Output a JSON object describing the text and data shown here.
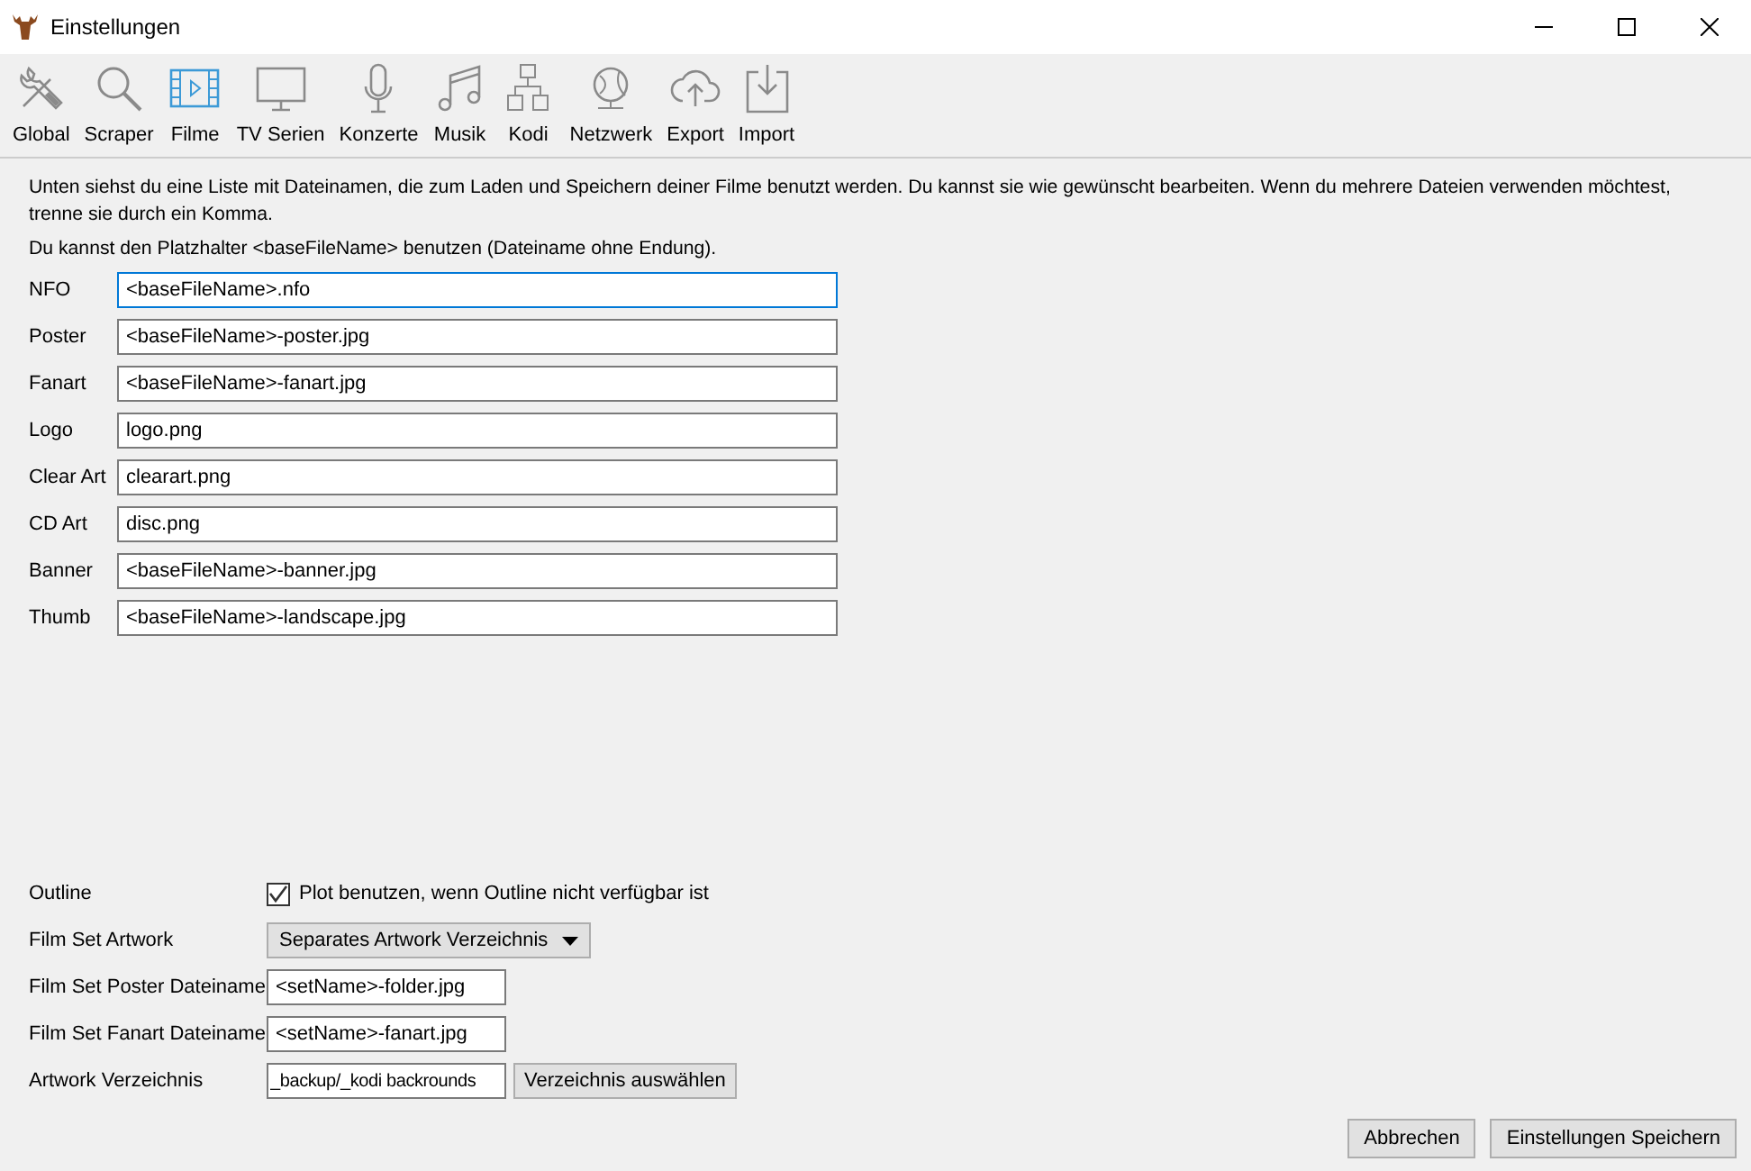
{
  "window": {
    "title": "Einstellungen"
  },
  "toolbar": [
    {
      "label": "Global",
      "selected": false
    },
    {
      "label": "Scraper",
      "selected": false
    },
    {
      "label": "Filme",
      "selected": true
    },
    {
      "label": "TV Serien",
      "selected": false
    },
    {
      "label": "Konzerte",
      "selected": false
    },
    {
      "label": "Musik",
      "selected": false
    },
    {
      "label": "Kodi",
      "selected": false
    },
    {
      "label": "Netzwerk",
      "selected": false
    },
    {
      "label": "Export",
      "selected": false
    },
    {
      "label": "Import",
      "selected": false
    }
  ],
  "intro": "Unten siehst du eine Liste mit Dateinamen, die zum Laden und Speichern deiner Filme benutzt werden. Du kannst sie wie gewünscht bearbeiten. Wenn du mehrere Dateien verwenden möchtest, trenne sie durch ein Komma.",
  "hint": "Du kannst den Platzhalter <baseFileName> benutzen (Dateiname ohne Endung).",
  "filenames": [
    {
      "label": "NFO",
      "value": "<baseFileName>.nfo",
      "focused": true
    },
    {
      "label": "Poster",
      "value": "<baseFileName>-poster.jpg",
      "focused": false
    },
    {
      "label": "Fanart",
      "value": "<baseFileName>-fanart.jpg",
      "focused": false
    },
    {
      "label": "Logo",
      "value": "logo.png",
      "focused": false
    },
    {
      "label": "Clear Art",
      "value": "clearart.png",
      "focused": false
    },
    {
      "label": "CD Art",
      "value": "disc.png",
      "focused": false
    },
    {
      "label": "Banner",
      "value": "<baseFileName>-banner.jpg",
      "focused": false
    },
    {
      "label": "Thumb",
      "value": "<baseFileName>-landscape.jpg",
      "focused": false
    }
  ],
  "options": [
    {
      "kind": "checkbox",
      "label": "Outline",
      "text": "Plot benutzen, wenn Outline nicht verfügbar ist",
      "checked": true
    },
    {
      "kind": "dropdown",
      "label": "Film Set Artwork",
      "value": "Separates Artwork Verzeichnis"
    },
    {
      "kind": "text",
      "label": "Film Set Poster Dateiname",
      "value": "<setName>-folder.jpg"
    },
    {
      "kind": "text",
      "label": "Film Set Fanart Dateiname",
      "value": "<setName>-fanart.jpg"
    },
    {
      "kind": "folder",
      "label": "Artwork Verzeichnis",
      "value": "_backup/_kodi backrounds",
      "button": "Verzeichnis auswählen"
    }
  ],
  "buttons": [
    "Abbrechen",
    "Einstellungen Speichern"
  ]
}
